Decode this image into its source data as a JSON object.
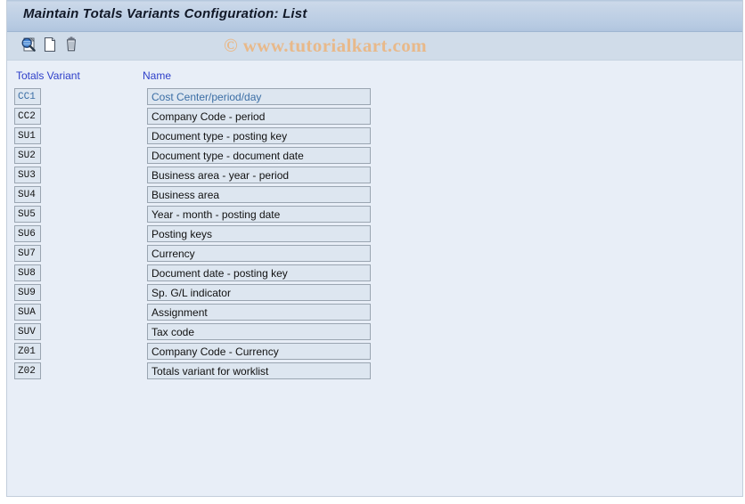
{
  "window": {
    "title": "Maintain Totals Variants Configuration: List"
  },
  "toolbar": {
    "buttons": [
      {
        "name": "display-details-button",
        "icon": "magnifier-document-icon",
        "tooltip": "Details"
      },
      {
        "name": "new-entries-button",
        "icon": "new-document-icon",
        "tooltip": "New Entries"
      },
      {
        "name": "delete-button",
        "icon": "trash-can-icon",
        "tooltip": "Delete"
      }
    ]
  },
  "watermark": {
    "text": "© www.tutorialkart.com",
    "color": "#e8b98a"
  },
  "table": {
    "columns": [
      {
        "key": "variant",
        "label": "Totals Variant"
      },
      {
        "key": "name",
        "label": "Name"
      }
    ],
    "header_color": "#2d3ec9",
    "selected_row_color": "#3b6ea5",
    "rows": [
      {
        "variant": "CC1",
        "name": "Cost Center/period/day",
        "selected": true
      },
      {
        "variant": "CC2",
        "name": "Company Code - period",
        "selected": false
      },
      {
        "variant": "SU1",
        "name": "Document type - posting key",
        "selected": false
      },
      {
        "variant": "SU2",
        "name": "Document type - document date",
        "selected": false
      },
      {
        "variant": "SU3",
        "name": "Business area - year - period",
        "selected": false
      },
      {
        "variant": "SU4",
        "name": "Business area",
        "selected": false
      },
      {
        "variant": "SU5",
        "name": "Year - month - posting date",
        "selected": false
      },
      {
        "variant": "SU6",
        "name": "Posting keys",
        "selected": false
      },
      {
        "variant": "SU7",
        "name": "Currency",
        "selected": false
      },
      {
        "variant": "SU8",
        "name": "Document date - posting key",
        "selected": false
      },
      {
        "variant": "SU9",
        "name": "Sp. G/L indicator",
        "selected": false
      },
      {
        "variant": "SUA",
        "name": "Assignment",
        "selected": false
      },
      {
        "variant": "SUV",
        "name": "Tax code",
        "selected": false
      },
      {
        "variant": "Z01",
        "name": "Company Code - Currency",
        "selected": false
      },
      {
        "variant": "Z02",
        "name": "Totals variant for worklist",
        "selected": false
      }
    ]
  }
}
